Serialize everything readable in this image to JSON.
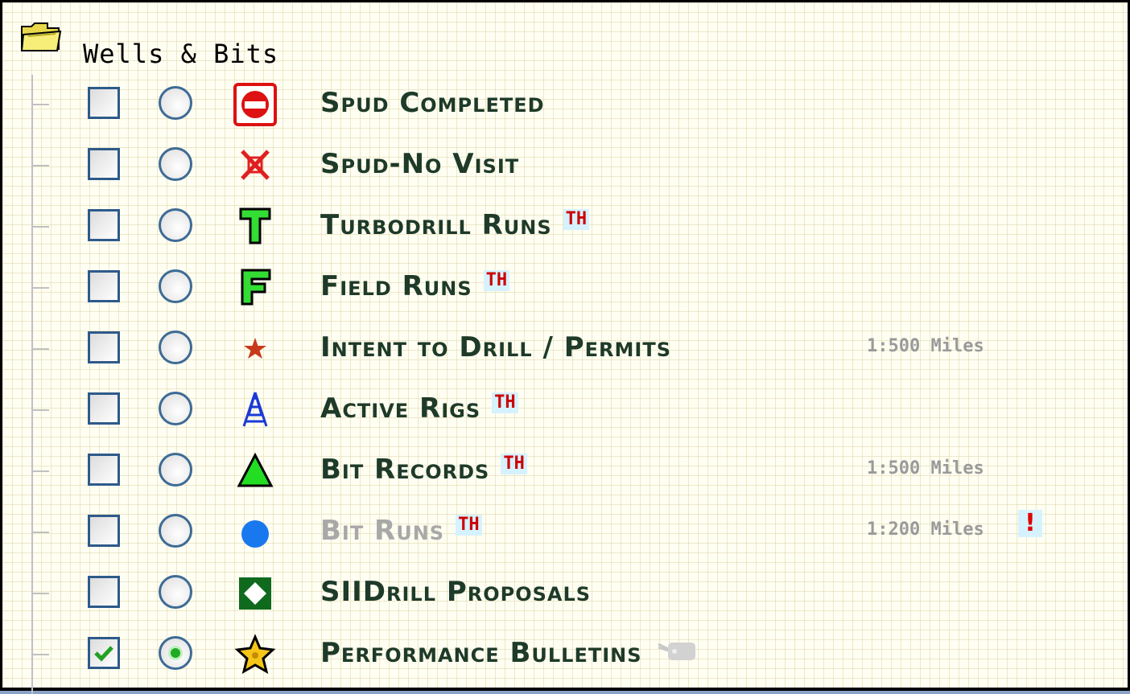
{
  "panel": {
    "group_title": "Wells & Bits",
    "folder_icon": "folder-open-icon"
  },
  "layers": [
    {
      "label": "Spud Completed",
      "icon": "stop-sign-icon",
      "checked": false,
      "selected": false,
      "th": false,
      "scale": "",
      "warning": "",
      "dim": false
    },
    {
      "label": "Spud-No Visit",
      "icon": "x-mark-icon",
      "checked": false,
      "selected": false,
      "th": false,
      "scale": "",
      "warning": "",
      "dim": false
    },
    {
      "label": "Turbodrill Runs",
      "icon": "letter-t-icon",
      "checked": false,
      "selected": false,
      "th": true,
      "th_text": "TH",
      "scale": "",
      "warning": "",
      "dim": false
    },
    {
      "label": "Field Runs",
      "icon": "letter-f-icon",
      "checked": false,
      "selected": false,
      "th": true,
      "th_text": "TH",
      "scale": "",
      "warning": "",
      "dim": false
    },
    {
      "label": "Intent to Drill / Permits",
      "icon": "star-small-icon",
      "checked": false,
      "selected": false,
      "th": false,
      "scale": "1:500 Miles",
      "warning": "",
      "dim": false
    },
    {
      "label": "Active Rigs",
      "icon": "rig-tower-icon",
      "checked": false,
      "selected": false,
      "th": true,
      "th_text": "TH",
      "scale": "",
      "warning": "",
      "dim": false
    },
    {
      "label": "Bit Records",
      "icon": "green-triangle-icon",
      "checked": false,
      "selected": false,
      "th": true,
      "th_text": "TH",
      "scale": "1:500 Miles",
      "warning": "",
      "dim": false
    },
    {
      "label": "Bit Runs",
      "icon": "blue-circle-icon",
      "checked": false,
      "selected": false,
      "th": true,
      "th_text": "TH",
      "scale": "1:200 Miles",
      "warning": "!",
      "dim": true
    },
    {
      "label": "SIIDrill Proposals",
      "icon": "diamond-square-icon",
      "checked": false,
      "selected": false,
      "th": false,
      "scale": "",
      "warning": "",
      "dim": false
    },
    {
      "label": "Performance Bulletins",
      "icon": "gold-star-icon",
      "checked": true,
      "selected": true,
      "th": false,
      "scale": "",
      "warning": "",
      "dim": false,
      "tag_icon": "tag-icon"
    }
  ],
  "colors": {
    "label": "#1e3a28",
    "th_text": "#cc0000",
    "th_bg": "#d6f2ff",
    "checkbox_border": "#2d5a8a"
  }
}
